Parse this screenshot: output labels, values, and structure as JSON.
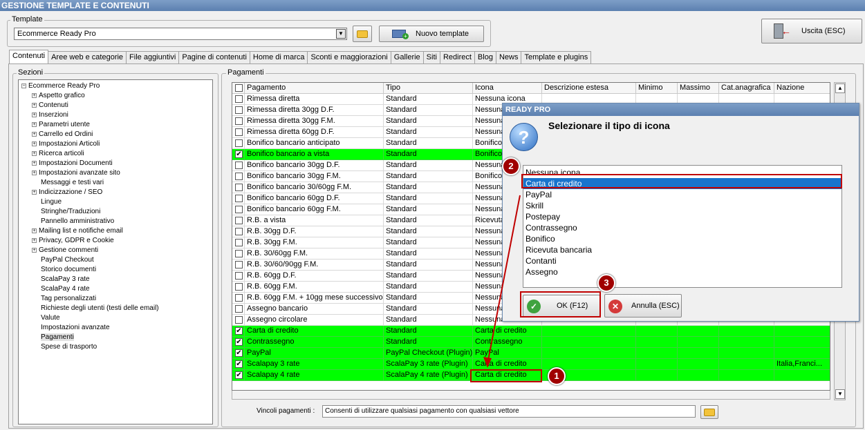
{
  "window_title": "GESTIONE TEMPLATE E CONTENUTI",
  "template_group": {
    "label": "Template",
    "selected": "Ecommerce Ready Pro",
    "new_template_label": "Nuovo template",
    "exit_label": "Uscita (ESC)"
  },
  "tabs": [
    "Contenuti",
    "Aree web e categorie",
    "File aggiuntivi",
    "Pagine di contenuti",
    "Home di marca",
    "Sconti e maggiorazioni",
    "Gallerie",
    "Siti",
    "Redirect",
    "Blog",
    "News",
    "Template e plugins"
  ],
  "sections": {
    "label": "Sezioni",
    "root": "Ecommerce Ready Pro",
    "items": [
      {
        "label": "Aspetto grafico",
        "expand": true
      },
      {
        "label": "Contenuti",
        "expand": true
      },
      {
        "label": "Inserzioni",
        "expand": true
      },
      {
        "label": "Parametri utente",
        "expand": true
      },
      {
        "label": "Carrello ed Ordini",
        "expand": true
      },
      {
        "label": "Impostazioni Articoli",
        "expand": true
      },
      {
        "label": "Ricerca articoli",
        "expand": true
      },
      {
        "label": "Impostazioni Documenti",
        "expand": true
      },
      {
        "label": "Impostazioni avanzate sito",
        "expand": true
      },
      {
        "label": "Messaggi e testi vari",
        "expand": false
      },
      {
        "label": "Indicizzazione / SEO",
        "expand": true
      },
      {
        "label": "Lingue",
        "expand": false
      },
      {
        "label": "Stringhe/Traduzioni",
        "expand": false
      },
      {
        "label": "Pannello amministrativo",
        "expand": false
      },
      {
        "label": "Mailing list e notifiche email",
        "expand": true
      },
      {
        "label": "Privacy, GDPR e Cookie",
        "expand": true
      },
      {
        "label": "Gestione commenti",
        "expand": true
      },
      {
        "label": "PayPal Checkout",
        "expand": false
      },
      {
        "label": "Storico documenti",
        "expand": false
      },
      {
        "label": "ScalaPay 3 rate",
        "expand": false
      },
      {
        "label": "ScalaPay 4 rate",
        "expand": false
      },
      {
        "label": "Tag personalizzati",
        "expand": false
      },
      {
        "label": "Richieste degli utenti (testi delle email)",
        "expand": false
      },
      {
        "label": "Valute",
        "expand": false
      },
      {
        "label": "Impostazioni avanzate",
        "expand": false
      },
      {
        "label": "Pagamenti",
        "expand": false
      },
      {
        "label": "Spese di trasporto",
        "expand": false
      }
    ]
  },
  "payments": {
    "label": "Pagamenti",
    "columns": [
      "Pagamento",
      "Tipo",
      "Icona",
      "Descrizione estesa",
      "Minimo",
      "Massimo",
      "Cat.anagrafica",
      "Nazione"
    ],
    "rows": [
      {
        "pagamento": "Rimessa diretta",
        "tipo": "Standard",
        "icona": "Nessuna icona",
        "checked": false,
        "hl": false,
        "nazione": ""
      },
      {
        "pagamento": "Rimessa diretta 30gg D.F.",
        "tipo": "Standard",
        "icona": "Nessuna icona",
        "checked": false,
        "hl": false,
        "nazione": ""
      },
      {
        "pagamento": "Rimessa diretta 30gg F.M.",
        "tipo": "Standard",
        "icona": "Nessuna icona",
        "checked": false,
        "hl": false,
        "nazione": ""
      },
      {
        "pagamento": "Rimessa diretta 60gg D.F.",
        "tipo": "Standard",
        "icona": "Nessuna icona",
        "checked": false,
        "hl": false,
        "nazione": ""
      },
      {
        "pagamento": "Bonifico bancario anticipato",
        "tipo": "Standard",
        "icona": "Bonifico",
        "checked": false,
        "hl": false,
        "nazione": ""
      },
      {
        "pagamento": "Bonifico bancario a vista",
        "tipo": "Standard",
        "icona": "Bonifico",
        "checked": true,
        "hl": true,
        "nazione": ""
      },
      {
        "pagamento": "Bonifico bancario 30gg D.F.",
        "tipo": "Standard",
        "icona": "Nessuna icona",
        "checked": false,
        "hl": false,
        "nazione": ""
      },
      {
        "pagamento": "Bonifico bancario 30gg F.M.",
        "tipo": "Standard",
        "icona": "Bonifico",
        "checked": false,
        "hl": false,
        "nazione": ""
      },
      {
        "pagamento": "Bonifico bancario 30/60gg F.M.",
        "tipo": "Standard",
        "icona": "Nessuna icona",
        "checked": false,
        "hl": false,
        "nazione": ""
      },
      {
        "pagamento": "Bonifico bancario 60gg D.F.",
        "tipo": "Standard",
        "icona": "Nessuna icona",
        "checked": false,
        "hl": false,
        "nazione": ""
      },
      {
        "pagamento": "Bonifico bancario 60gg F.M.",
        "tipo": "Standard",
        "icona": "Nessuna icona",
        "checked": false,
        "hl": false,
        "nazione": ""
      },
      {
        "pagamento": "R.B. a vista",
        "tipo": "Standard",
        "icona": "Ricevuta bancaria",
        "checked": false,
        "hl": false,
        "nazione": ""
      },
      {
        "pagamento": "R.B. 30gg D.F.",
        "tipo": "Standard",
        "icona": "Nessuna icona",
        "checked": false,
        "hl": false,
        "nazione": ""
      },
      {
        "pagamento": "R.B. 30gg F.M.",
        "tipo": "Standard",
        "icona": "Nessuna icona",
        "checked": false,
        "hl": false,
        "nazione": ""
      },
      {
        "pagamento": "R.B. 30/60gg F.M.",
        "tipo": "Standard",
        "icona": "Nessuna icona",
        "checked": false,
        "hl": false,
        "nazione": ""
      },
      {
        "pagamento": "R.B. 30/60/90gg F.M.",
        "tipo": "Standard",
        "icona": "Nessuna icona",
        "checked": false,
        "hl": false,
        "nazione": ""
      },
      {
        "pagamento": "R.B. 60gg D.F.",
        "tipo": "Standard",
        "icona": "Nessuna icona",
        "checked": false,
        "hl": false,
        "nazione": ""
      },
      {
        "pagamento": "R.B. 60gg F.M.",
        "tipo": "Standard",
        "icona": "Nessuna icona",
        "checked": false,
        "hl": false,
        "nazione": ""
      },
      {
        "pagamento": "R.B. 60gg F.M. + 10gg mese successivo",
        "tipo": "Standard",
        "icona": "Nessuna icona",
        "checked": false,
        "hl": false,
        "nazione": ""
      },
      {
        "pagamento": "Assegno bancario",
        "tipo": "Standard",
        "icona": "Nessuna icona",
        "checked": false,
        "hl": false,
        "nazione": ""
      },
      {
        "pagamento": "Assegno circolare",
        "tipo": "Standard",
        "icona": "Nessuna icona",
        "checked": false,
        "hl": false,
        "nazione": ""
      },
      {
        "pagamento": "Carta di credito",
        "tipo": "Standard",
        "icona": "Carta di credito",
        "checked": true,
        "hl": true,
        "nazione": ""
      },
      {
        "pagamento": "Contrassegno",
        "tipo": "Standard",
        "icona": "Contrassegno",
        "checked": true,
        "hl": true,
        "nazione": ""
      },
      {
        "pagamento": "PayPal",
        "tipo": "PayPal Checkout (Plugin)",
        "icona": "PayPal",
        "checked": true,
        "hl": true,
        "nazione": ""
      },
      {
        "pagamento": "Scalapay 3 rate",
        "tipo": "ScalaPay 3 rate (Plugin)",
        "icona": "Carta di credito",
        "checked": true,
        "hl": true,
        "nazione": "Italia,Franci..."
      },
      {
        "pagamento": "Scalapay 4 rate",
        "tipo": "ScalaPay 4 rate (Plugin)",
        "icona": "Carta di credito",
        "checked": true,
        "hl": true,
        "nazione": ""
      }
    ]
  },
  "constraints": {
    "label": "Vincoli pagamenti :",
    "value": "Consenti di utilizzare qualsiasi pagamento con qualsiasi vettore"
  },
  "dialog": {
    "title": "READY PRO",
    "question": "Selezionare il tipo di icona",
    "options": [
      "Nessuna icona",
      "Carta di credito",
      "PayPal",
      "Skrill",
      "Postepay",
      "Contrassegno",
      "Bonifico",
      "Ricevuta bancaria",
      "Contanti",
      "Assegno"
    ],
    "selected_index": 1,
    "ok_label": "OK (F12)",
    "cancel_label": "Annulla (ESC)"
  },
  "annotations": [
    "1",
    "2",
    "3"
  ],
  "colors": {
    "highlight": "#00ff00",
    "selection": "#1874cd",
    "marker": "#c00000"
  }
}
